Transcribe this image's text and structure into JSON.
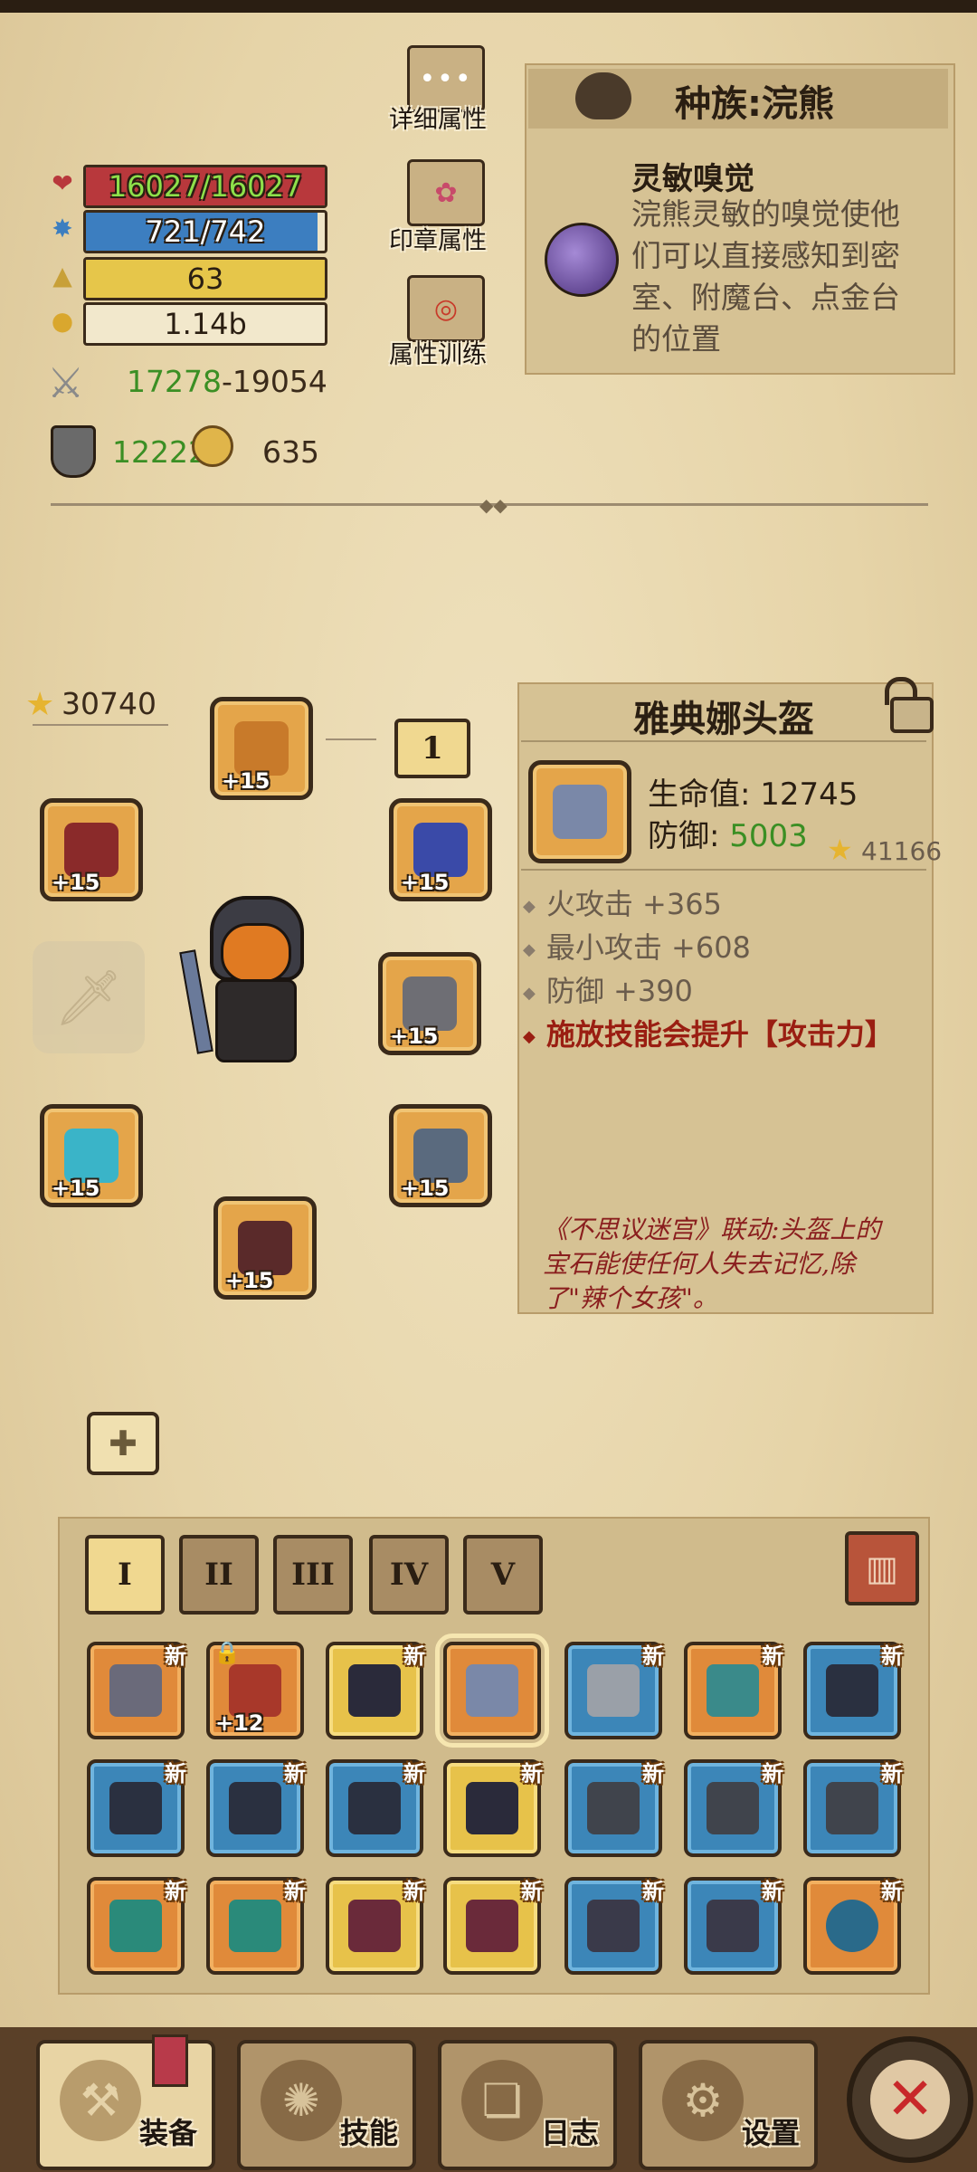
{
  "stats": {
    "hp": "16027/16027",
    "mana": "721/742",
    "level": "63",
    "gold": "1.14b",
    "attack_min": "17278",
    "attack_max": "-19054",
    "defense": "12222",
    "souls": "635",
    "hp_fraction": 1.0,
    "mana_fraction": 0.97,
    "level_fraction": 1.0
  },
  "side_buttons": {
    "details": "详细属性",
    "seals": "印章属性",
    "training": "属性训练"
  },
  "race": {
    "title": "种族:浣熊",
    "trait_name": "灵敏嗅觉",
    "trait_desc": "浣熊灵敏的嗅觉使他们可以直接感知到密室、附魔台、点金台的位置"
  },
  "equipment": {
    "power": "30740",
    "page_number": "1",
    "slots_plus": [
      "+15",
      "+15",
      "+15",
      "+15",
      "+15",
      "+15",
      "+15"
    ]
  },
  "item": {
    "name": "雅典娜头盔",
    "hp_label": "生命值:",
    "hp_value": "12745",
    "def_label": "防御:",
    "def_value": "5003",
    "power": "41166",
    "affixes": [
      "火攻击 +365",
      "最小攻击 +608",
      "防御 +390"
    ],
    "special": "施放技能会提升【攻击力】",
    "lore": "《不思议迷宫》联动:头盔上的宝石能使任何人失去记忆,除了\"辣个女孩\"。"
  },
  "inventory": {
    "tabs": [
      "I",
      "II",
      "III",
      "IV",
      "V"
    ],
    "new_label": "新",
    "locked_plus": "+12"
  },
  "bottom_nav": {
    "equip": "装备",
    "skills": "技能",
    "log": "日志",
    "settings": "设置"
  },
  "colors": {
    "hp": "#b8383c",
    "mana": "#3c7ec0",
    "level": "#e6c64a",
    "stat_green": "#3b8f24",
    "special_red": "#9a1e12"
  }
}
